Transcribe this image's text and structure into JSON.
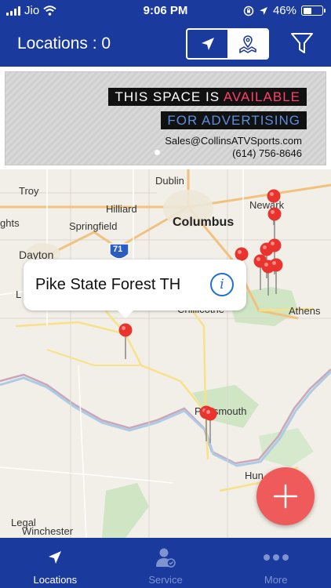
{
  "status_bar": {
    "carrier": "Jio",
    "time": "9:06 PM",
    "battery": "46%",
    "battery_level": 0.46
  },
  "header": {
    "title": "Locations : 0",
    "view_toggle": [
      "navigate-icon",
      "map-icon"
    ],
    "filter_icon": "funnel-icon"
  },
  "ad": {
    "line1_prefix": "THIS SPACE IS",
    "line1_highlight": "AVAILABLE",
    "line2": "FOR ADVERTISING",
    "email": "Sales@CollinsATVSports.com",
    "phone": "(614) 756-8646",
    "colors": {
      "highlight": "#ff3f6c",
      "line2": "#5a8fe0"
    }
  },
  "map": {
    "cities": {
      "troy": "Troy",
      "dublin": "Dublin",
      "newark": "Newark",
      "hilliard": "Hilliard",
      "springfield": "Springfield",
      "columbus": "Columbus",
      "ghts": "ghts",
      "dayton": "Dayton",
      "chillicothe": "Chillicothe",
      "athens": "Athens",
      "portsmouth": "Portsmouth",
      "hun": "Hun",
      "legal": "Legal",
      "winchester": "Winchester",
      "l": "L"
    },
    "highway_shield": "71",
    "callout": {
      "title": "Pike State Forest TH",
      "info_icon": "info-icon"
    },
    "pin_color": "#e9332f"
  },
  "fab": {
    "icon": "plus-icon",
    "color": "#ef5a5a"
  },
  "tabs": [
    {
      "label": "Locations",
      "icon": "location-arrow-icon",
      "active": true
    },
    {
      "label": "Service",
      "icon": "service-person-icon",
      "active": false
    },
    {
      "label": "More",
      "icon": "more-dots-icon",
      "active": false
    }
  ],
  "colors": {
    "primary": "#1a3a9e"
  }
}
